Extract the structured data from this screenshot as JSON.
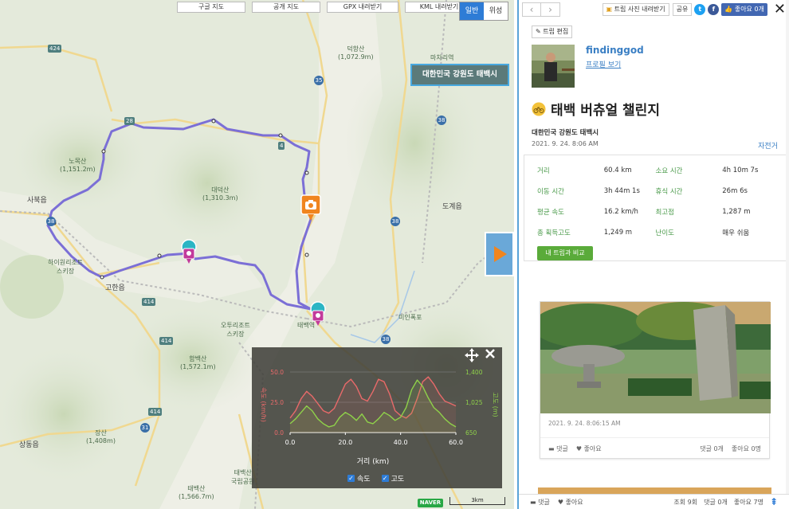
{
  "map": {
    "toolbar": [
      "구글 지도",
      "공개 지도",
      "GPX 내려받기",
      "KML 내려받기"
    ],
    "map_types": [
      "일반",
      "위성"
    ],
    "active_map_type": "일반",
    "region_label": "대한민국 강원도 태백시",
    "places": [
      {
        "name": "덕항산",
        "sub": "(1,072.9m)"
      },
      {
        "name": "노목산",
        "sub": "(1,151.2m)"
      },
      {
        "name": "대덕산",
        "sub": "(1,310.3m)"
      },
      {
        "name": "사북읍",
        "sub": ""
      },
      {
        "name": "도계읍",
        "sub": ""
      },
      {
        "name": "하이원리조트",
        "sub": "스키장"
      },
      {
        "name": "고한읍",
        "sub": ""
      },
      {
        "name": "태백역",
        "sub": ""
      },
      {
        "name": "오투리조트",
        "sub": "스키장"
      },
      {
        "name": "함백산",
        "sub": "(1,572.1m)"
      },
      {
        "name": "장산",
        "sub": "(1,408m)"
      },
      {
        "name": "상동읍",
        "sub": ""
      },
      {
        "name": "태백산",
        "sub": "국립공원"
      },
      {
        "name": "태백산",
        "sub": "(1,566.7m)"
      },
      {
        "name": "마차리역",
        "sub": ""
      },
      {
        "name": "미인폭포",
        "sub": ""
      }
    ],
    "road_numbers": [
      "424",
      "28",
      "35",
      "38",
      "414",
      "31",
      "4"
    ],
    "naver_logo": "NAVER",
    "scale": "3km"
  },
  "chart_data": {
    "type": "line",
    "xlabel": "거리 (km)",
    "ylabel_left": "속도 (km/h)",
    "ylabel_right": "고도 (m)",
    "x_ticks": [
      0.0,
      20.0,
      40.0,
      60.0
    ],
    "x_tick_labels": [
      "0.0",
      "20.0",
      "40.0",
      "60.0"
    ],
    "y_left_ticks": [
      0.0,
      25.0,
      50.0
    ],
    "y_left_tick_labels": [
      "0.0",
      "25.0",
      "50.0"
    ],
    "y_right_ticks": [
      650,
      1025,
      1400
    ],
    "y_right_tick_labels": [
      "650",
      "1,025",
      "1,400"
    ],
    "xlim": [
      0,
      60
    ],
    "ylim_left": [
      0,
      50
    ],
    "ylim_right": [
      650,
      1400
    ],
    "series": [
      {
        "name": "속도",
        "axis": "left",
        "color": "#e86a6a",
        "x": [
          0,
          2,
          4,
          6,
          8,
          10,
          12,
          14,
          16,
          18,
          20,
          22,
          24,
          26,
          28,
          30,
          32,
          34,
          36,
          38,
          40,
          42,
          44,
          46,
          48,
          50,
          52,
          54,
          56,
          58,
          60
        ],
        "y": [
          12,
          18,
          28,
          34,
          30,
          24,
          18,
          16,
          20,
          30,
          40,
          44,
          38,
          28,
          26,
          34,
          44,
          42,
          32,
          18,
          14,
          12,
          16,
          28,
          42,
          46,
          40,
          32,
          26,
          24,
          22
        ]
      },
      {
        "name": "고도",
        "axis": "right",
        "color": "#8fd14a",
        "x": [
          0,
          2,
          4,
          6,
          8,
          10,
          12,
          14,
          16,
          18,
          20,
          22,
          24,
          26,
          28,
          30,
          32,
          34,
          36,
          38,
          40,
          42,
          44,
          46,
          48,
          50,
          52,
          54,
          56,
          58,
          60
        ],
        "y": [
          760,
          820,
          900,
          980,
          920,
          820,
          760,
          720,
          740,
          840,
          900,
          860,
          800,
          880,
          780,
          760,
          820,
          900,
          860,
          800,
          840,
          960,
          1180,
          1300,
          1220,
          1080,
          960,
          900,
          820,
          760,
          720
        ]
      }
    ],
    "legend": [
      "속도",
      "고도"
    ],
    "legend_checked": [
      true,
      true
    ]
  },
  "side": {
    "buttons": {
      "download_photos": "트립 사진 내려받기",
      "share": "공유",
      "like_fb": "좋아요 0개",
      "edit": "트립 편집",
      "compare": "내 트립과 비교"
    },
    "user": {
      "name": "findinggod",
      "profile_link": "프로필 보기"
    },
    "trip": {
      "title": "태백 버츄얼 챌린지",
      "region": "대한민국 강원도 태백시",
      "date": "2021. 9. 24. 8:06 AM",
      "activity": "자전거"
    },
    "stats": [
      {
        "label": "거리",
        "value": "60.4 km",
        "label2": "소요 시간",
        "value2": "4h 10m 7s"
      },
      {
        "label": "이동 시간",
        "value": "3h 44m 1s",
        "label2": "휴식 시간",
        "value2": "26m 6s"
      },
      {
        "label": "평균 속도",
        "value": "16.2 km/h",
        "label2": "최고점",
        "value2": "1,287 m"
      },
      {
        "label": "총 획득고도",
        "value": "1,249 m",
        "label2": "난이도",
        "value2": "매우 쉬움"
      }
    ],
    "photo": {
      "time": "2021. 9. 24. 8:06:15 AM",
      "comment": "댓글",
      "like": "좋아요",
      "comment_count": "댓글 0개",
      "like_count": "좋아요 0명"
    },
    "bottom": {
      "comment": "댓글",
      "like": "좋아요",
      "views": "조회 9회",
      "comments": "댓글 0개",
      "likes": "좋아요 7명"
    }
  }
}
